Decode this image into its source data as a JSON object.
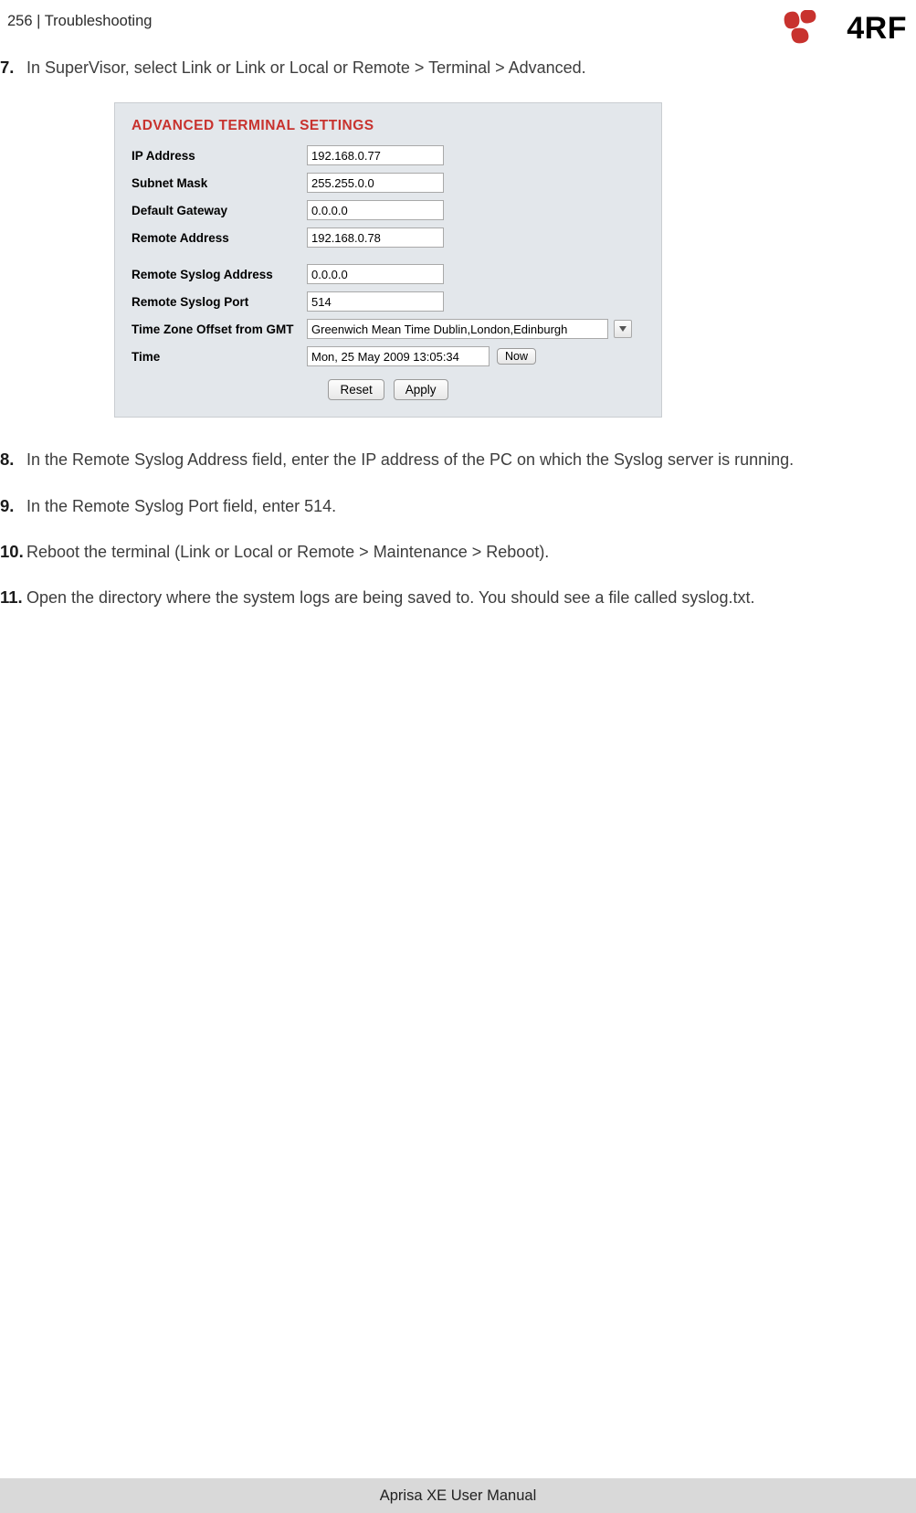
{
  "header": {
    "page_number": "256",
    "section": "Troubleshooting",
    "separator": "|",
    "brand_text": "4RF"
  },
  "steps": {
    "s7": {
      "num": "7.",
      "text": "In SuperVisor, select Link or Link or Local or Remote > Terminal > Advanced."
    },
    "s8": {
      "num": "8.",
      "text": "In the Remote Syslog Address field, enter the IP address of the PC on which the Syslog server is running."
    },
    "s9": {
      "num": "9.",
      "text": "In the Remote Syslog Port field, enter 514."
    },
    "s10": {
      "num": "10.",
      "text": "Reboot the terminal (Link or Local or Remote > Maintenance > Reboot)."
    },
    "s11": {
      "num": "11.",
      "text": "Open the directory where the system logs are being saved to. You should see a file called syslog.txt."
    }
  },
  "panel": {
    "title": "ADVANCED TERMINAL SETTINGS",
    "labels": {
      "ip": "IP Address",
      "mask": "Subnet Mask",
      "gw": "Default Gateway",
      "remote": "Remote Address",
      "syslog_addr": "Remote Syslog Address",
      "syslog_port": "Remote Syslog Port",
      "tz": "Time Zone Offset from GMT",
      "time": "Time"
    },
    "values": {
      "ip": "192.168.0.77",
      "mask": "255.255.0.0",
      "gw": "0.0.0.0",
      "remote": "192.168.0.78",
      "syslog_addr": "0.0.0.0",
      "syslog_port": "514",
      "tz": "Greenwich Mean Time Dublin,London,Edinburgh",
      "time": "Mon, 25 May 2009 13:05:34"
    },
    "buttons": {
      "now": "Now",
      "reset": "Reset",
      "apply": "Apply"
    }
  },
  "footer": {
    "text": "Aprisa XE User Manual"
  }
}
